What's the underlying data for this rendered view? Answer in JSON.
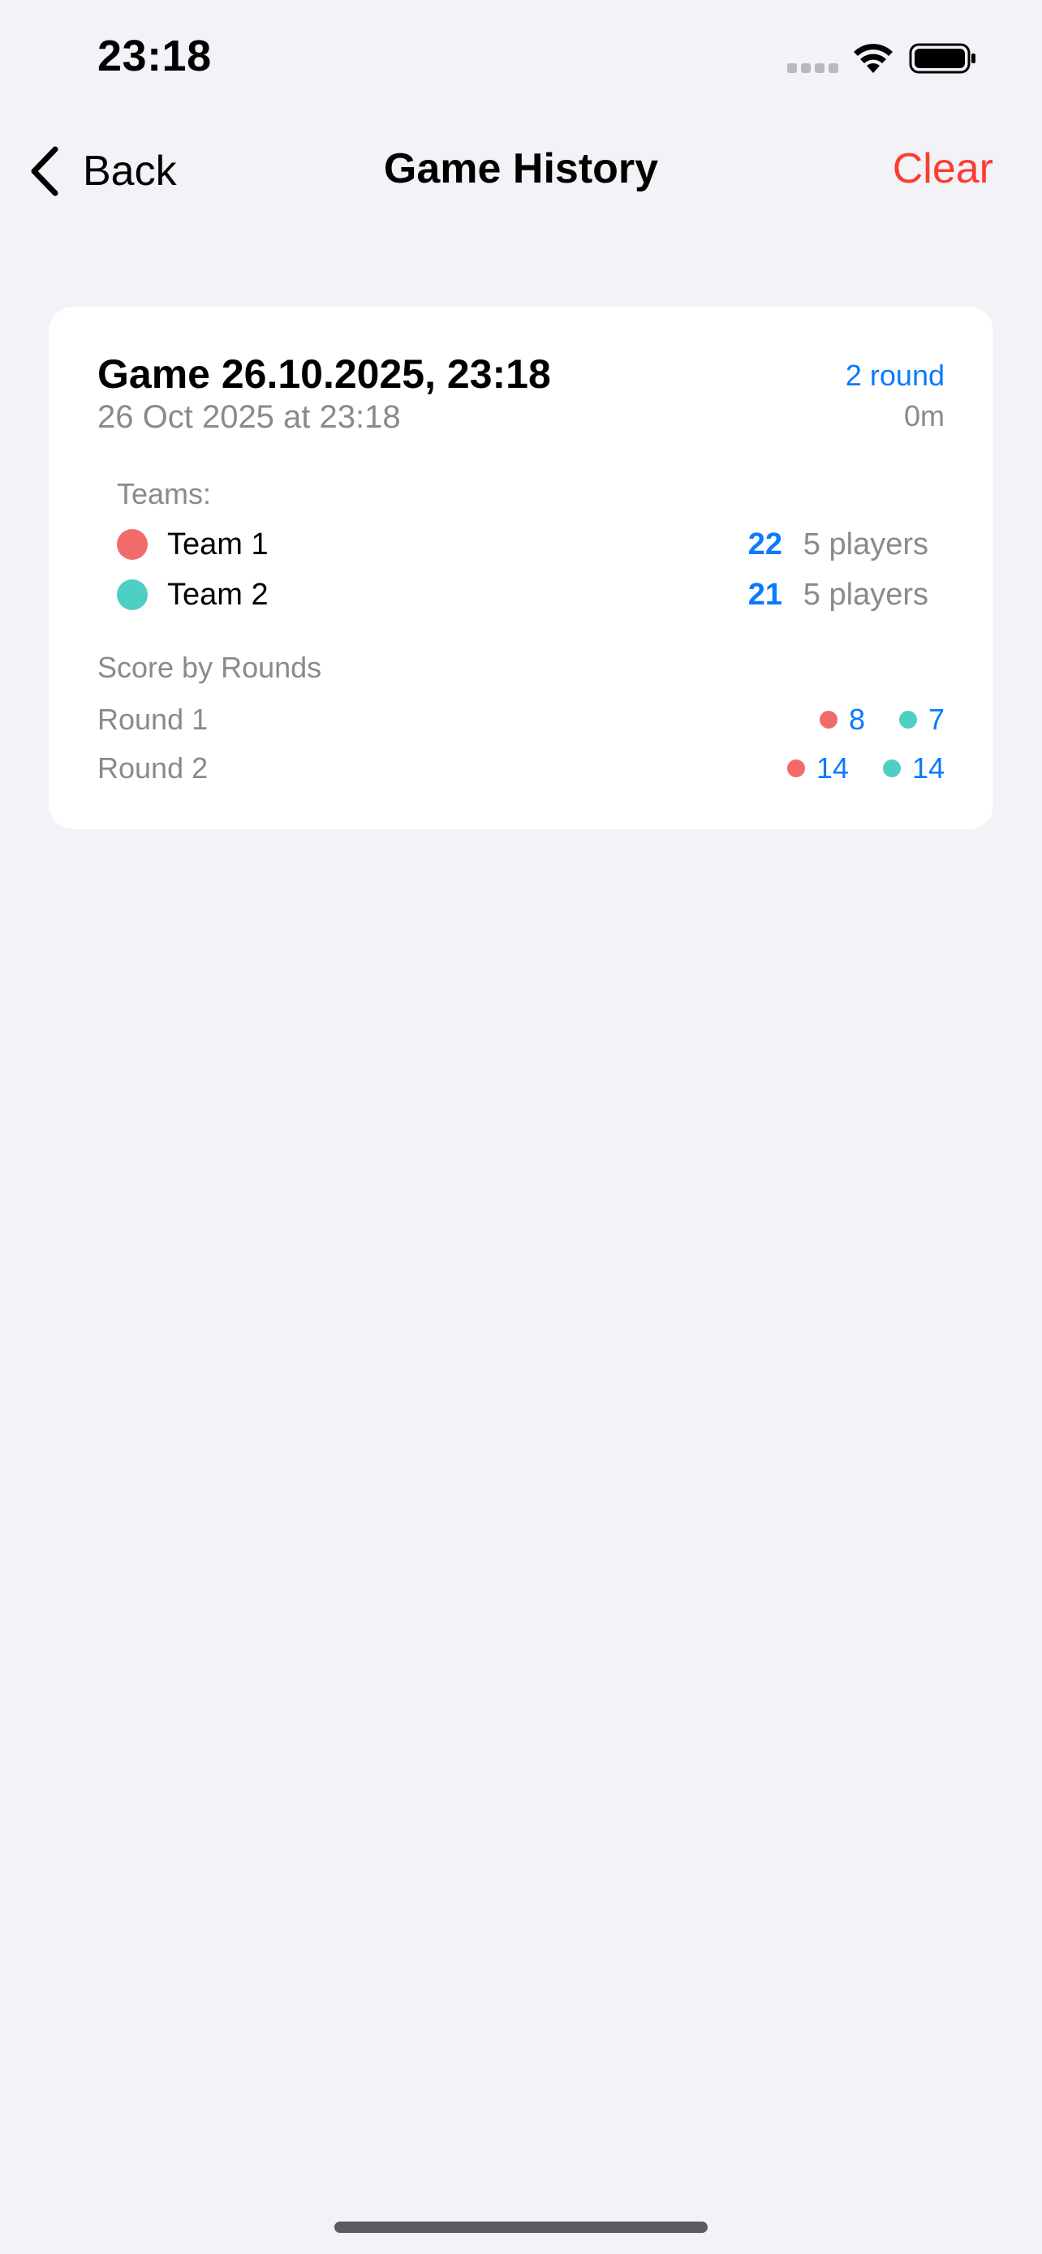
{
  "status_bar": {
    "time": "23:18"
  },
  "nav": {
    "back_label": "Back",
    "title": "Game History",
    "clear_label": "Clear"
  },
  "colors": {
    "background": "#f2f2f7",
    "accent_blue": "#0a7aff",
    "destructive_red": "#ff3b30",
    "team_1": "#f26b6b",
    "team_2": "#4fcfc3"
  },
  "games": [
    {
      "title": "Game 26.10.2025, 23:18",
      "date": "26 Oct 2025 at 23:18",
      "round_count": "2 round",
      "duration": "0m",
      "teams_label": "Teams:",
      "teams": [
        {
          "name": "Team 1",
          "score": "22",
          "players": "5 players",
          "color": "#f26b6b"
        },
        {
          "name": "Team 2",
          "score": "21",
          "players": "5 players",
          "color": "#4fcfc3"
        }
      ],
      "rounds_label": "Score by Rounds",
      "rounds": [
        {
          "name": "Round 1",
          "team_1_score": "8",
          "team_2_score": "7"
        },
        {
          "name": "Round 2",
          "team_1_score": "14",
          "team_2_score": "14"
        }
      ]
    }
  ]
}
